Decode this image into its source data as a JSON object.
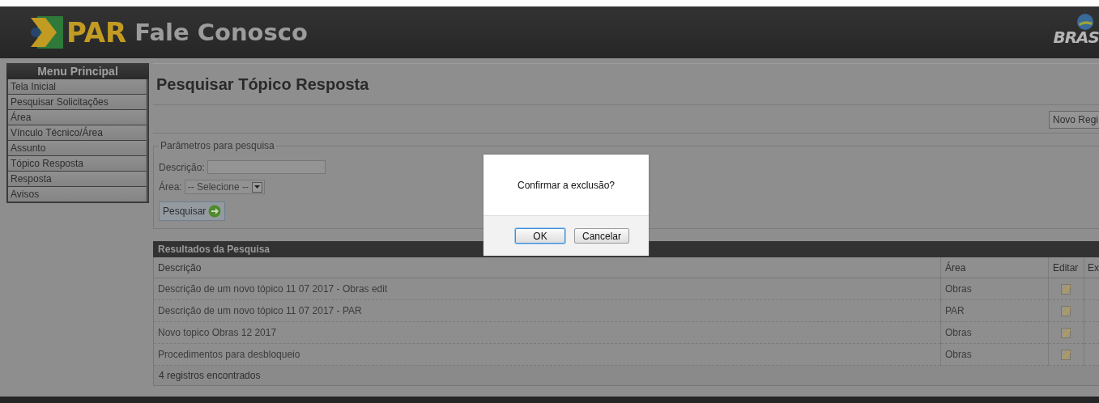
{
  "header": {
    "logo": "PAR",
    "title": "Fale Conosco",
    "brand": "BRAS"
  },
  "menu": {
    "title": "Menu Principal",
    "items": [
      {
        "label": "Tela Inicial"
      },
      {
        "label": "Pesquisar Solicitações"
      },
      {
        "label": "Área"
      },
      {
        "label": "Vínculo Técnico/Área"
      },
      {
        "label": "Assunto"
      },
      {
        "label": "Tópico Resposta"
      },
      {
        "label": "Resposta"
      },
      {
        "label": "Avisos"
      }
    ]
  },
  "page_title": "Pesquisar Tópico Resposta",
  "new_button": "Novo Regi",
  "search": {
    "legend": "Parâmetros para pesquisa",
    "fields": [
      {
        "kind": "text",
        "label": "Descrição:"
      },
      {
        "kind": "select",
        "label": "Área:",
        "value": "-- Selecione --"
      }
    ],
    "button": "Pesquisar"
  },
  "results": {
    "title": "Resultados da Pesquisa",
    "columns": [
      "Descrição",
      "Área",
      "Editar",
      "Ex"
    ],
    "rows": [
      {
        "description": "Descrição de um novo tópico 11 07 2017 - Obras edit",
        "area": "Obras"
      },
      {
        "description": "Descrição de um novo tópico 11 07 2017 - PAR",
        "area": "PAR"
      },
      {
        "description": "Novo topico Obras 12 2017",
        "area": "Obras"
      },
      {
        "description": "Procedimentos para desbloqueio",
        "area": "Obras"
      }
    ],
    "footer": "4 registros encontrados"
  },
  "dialog": {
    "message": "Confirmar a exclusão?",
    "buttons": [
      {
        "label": "OK",
        "selected": true
      },
      {
        "label": "Cancelar",
        "selected": false
      }
    ]
  }
}
